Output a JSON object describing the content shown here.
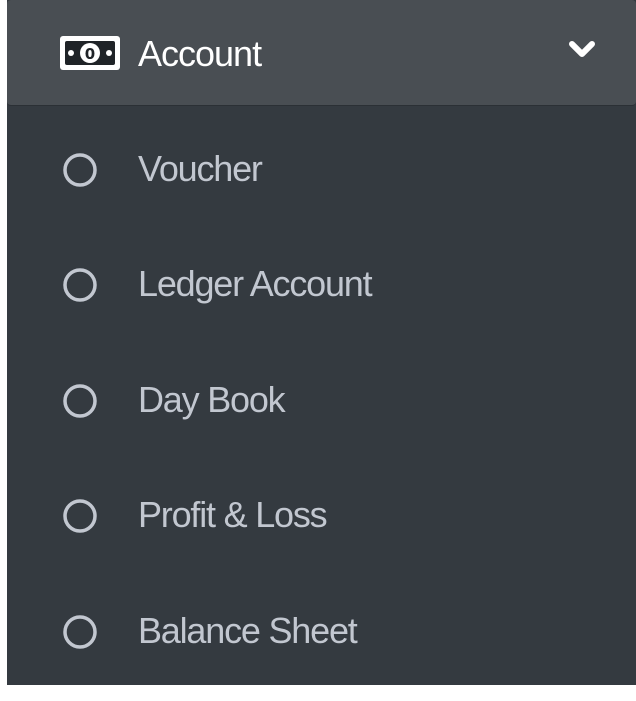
{
  "menu": {
    "header": {
      "label": "Account",
      "icon": "money-bill-icon",
      "toggle_icon": "chevron-down-icon",
      "expanded": true
    },
    "items": [
      {
        "label": "Voucher",
        "icon": "circle-outline-icon"
      },
      {
        "label": "Ledger Account",
        "icon": "circle-outline-icon"
      },
      {
        "label": "Day Book",
        "icon": "circle-outline-icon"
      },
      {
        "label": "Profit & Loss",
        "icon": "circle-outline-icon"
      },
      {
        "label": "Balance Sheet",
        "icon": "circle-outline-icon"
      }
    ]
  },
  "colors": {
    "sidebar_bg": "#343a40",
    "header_bg": "#494e53",
    "header_text": "#ffffff",
    "item_text": "#c2c7d0"
  }
}
